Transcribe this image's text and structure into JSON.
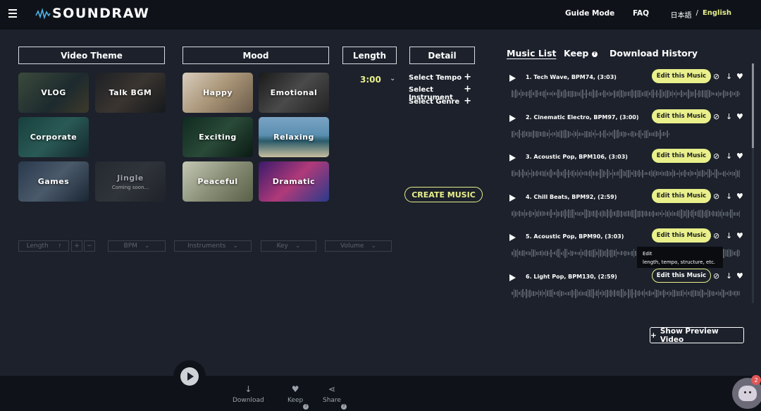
{
  "app": {
    "logo": "SOUNDRAW"
  },
  "nav": {
    "guide": "Guide Mode",
    "faq": "FAQ",
    "lang_jp": "日本語",
    "lang_sep": "/",
    "lang_en": "English"
  },
  "sections": {
    "video_theme": "Video Theme",
    "mood": "Mood",
    "length": "Length",
    "detail": "Detail"
  },
  "video_themes": [
    {
      "label": "VLOG"
    },
    {
      "label": "Talk BGM"
    },
    {
      "label": "Corporate"
    },
    {
      "label": "Games"
    },
    {
      "label": "Jingle",
      "sub": "Coming soon..."
    }
  ],
  "moods": [
    {
      "label": "Happy"
    },
    {
      "label": "Emotional"
    },
    {
      "label": "Exciting"
    },
    {
      "label": "Relaxing"
    },
    {
      "label": "Peaceful"
    },
    {
      "label": "Dramatic"
    }
  ],
  "length": {
    "value": "3:00"
  },
  "detail": {
    "tempo": "Select Tempo",
    "instrument": "Select Instrument",
    "genre": "Select Genre",
    "plus": "+"
  },
  "create_button": "CREATE MUSIC",
  "filters": {
    "length": "Length",
    "bpm": "BPM",
    "instruments": "Instruments",
    "key": "Key",
    "volume": "Volume",
    "plus": "+",
    "minus": "−"
  },
  "tabs": {
    "music_list": "Music List",
    "keep": "Keep",
    "download_history": "Download History"
  },
  "tracks": [
    {
      "title": "1. Tech Wave, BPM74, (3:03)",
      "edit": "Edit this Music"
    },
    {
      "title": "2. Cinematic Electro, BPM97, (3:00)",
      "edit": "Edit this Music"
    },
    {
      "title": "3. Acoustic Pop, BPM106, (3:03)",
      "edit": "Edit this Music"
    },
    {
      "title": "4. Chill Beats, BPM92, (2:59)",
      "edit": "Edit this Music"
    },
    {
      "title": "5. Acoustic Pop, BPM90, (3:03)",
      "edit": "Edit this Music"
    },
    {
      "title": "6. Light Pop, BPM130, (2:59)",
      "edit": "Edit this Music"
    }
  ],
  "tooltip": {
    "title": "Edit",
    "body": "length, tempo, structure, etc."
  },
  "preview_button": "Show Preview Video",
  "bottom": {
    "download": "Download",
    "keep": "Keep",
    "share": "Share"
  },
  "chat_badge": "2",
  "colors": {
    "accent": "#e9f08b",
    "background": "#1c212b",
    "bar": "#0f1319"
  }
}
